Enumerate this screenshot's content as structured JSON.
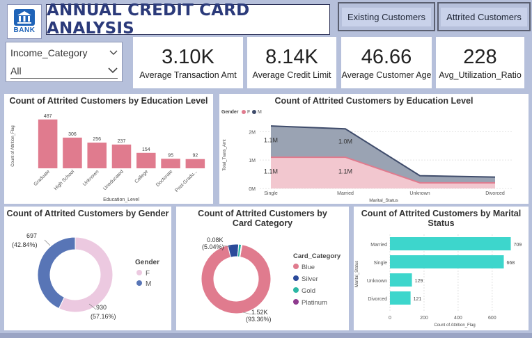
{
  "header": {
    "logo_text": "BANK",
    "title": "ANNUAL CREDIT CARD ANALYSIS",
    "nav_existing": "Existing Customers",
    "nav_attrited": "Attrited Customers"
  },
  "slicer": {
    "label": "Income_Category",
    "value": "All"
  },
  "kpis": [
    {
      "value": "3.10K",
      "label": "Average Transaction Amt"
    },
    {
      "value": "8.14K",
      "label": "Average Credit Limit"
    },
    {
      "value": "46.66",
      "label": "Average Customer Age"
    },
    {
      "value": "228",
      "label": "Avg_Utilization_Ratio"
    }
  ],
  "colors": {
    "pink": "#e07b8e",
    "pinklight": "#f2c7cf",
    "blue": "#5875b6",
    "navy": "#3f4c6b",
    "teal": "#3dd6cc",
    "gray": "#96a1b3"
  },
  "chart_data": [
    {
      "type": "bar",
      "title": "Count of Attrited Customers by Education Level",
      "categories": [
        "Graduate",
        "High School",
        "Unknown",
        "Uneducated",
        "College",
        "Doctorate",
        "Post-Gradu..."
      ],
      "values": [
        487,
        306,
        256,
        237,
        154,
        95,
        92
      ],
      "xlabel": "Education_Level",
      "ylabel": "Count of Attrition_Flag",
      "ylim": [
        0,
        520
      ]
    },
    {
      "type": "area",
      "title": "Count of Attrited Customers by Education Level",
      "legend_title": "Gender",
      "x": [
        "Single",
        "Married",
        "Unknown",
        "Divorced"
      ],
      "series": [
        {
          "name": "F",
          "values": [
            1.1,
            1.1,
            0.2,
            0.2
          ]
        },
        {
          "name": "M",
          "values": [
            1.1,
            1.0,
            0.25,
            0.2
          ]
        }
      ],
      "data_labels": {
        "M": [
          "1.1M",
          "1.0M"
        ],
        "F": [
          "1.1M",
          "1.1M"
        ]
      },
      "yticks": [
        "0M",
        "1M",
        "2M"
      ],
      "xlabel": "Marital_Status",
      "ylabel": "Total_Trans_Amt",
      "ylim": [
        0,
        2.4
      ]
    },
    {
      "type": "pie",
      "title": "Count of Attrited Customers by Gender",
      "legend_title": "Gender",
      "labels": [
        "F",
        "M"
      ],
      "values": [
        930,
        697
      ],
      "percent_labels": [
        "930\n(57.16%)",
        "697\n(42.84%)"
      ]
    },
    {
      "type": "pie",
      "title": "Count of Attrited Customers by Card Category",
      "legend_title": "Card_Category",
      "labels": [
        "Blue",
        "Silver",
        "Gold",
        "Platinum"
      ],
      "values": [
        1519,
        82,
        21,
        5
      ],
      "data_labels": [
        "1.52K\n(93.36%)",
        "0.08K\n(5.04%)"
      ]
    },
    {
      "type": "bar",
      "orientation": "horizontal",
      "title": "Count of Attrited Customers by Marital Status",
      "categories": [
        "Married",
        "Single",
        "Unknown",
        "Divorced"
      ],
      "values": [
        709,
        668,
        129,
        121
      ],
      "xticks": [
        0,
        200,
        400,
        600
      ],
      "xlabel": "Count of Attrition_Flag",
      "ylabel": "Marital_Status",
      "xlim": [
        0,
        760
      ]
    }
  ]
}
